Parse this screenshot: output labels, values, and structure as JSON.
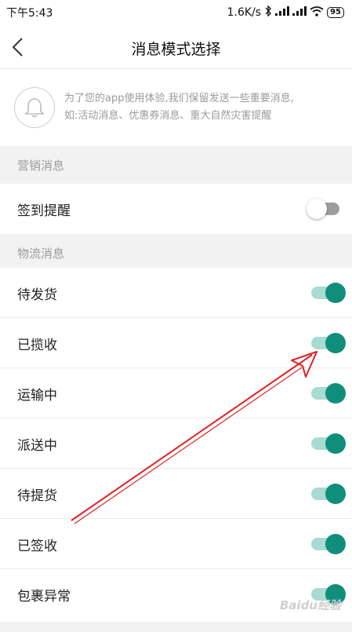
{
  "status_bar": {
    "time": "下午5:43",
    "speed": "1.6K/s",
    "battery": "95"
  },
  "header": {
    "title": "消息模式选择"
  },
  "notice": {
    "icon": "bell-icon",
    "line1": "为了您的app使用体验,我们保留发送一些重要消息,",
    "line2": "如:活动消息、优惠券消息、重大自然灾害提醒"
  },
  "sections": {
    "marketing": {
      "title": "营销消息",
      "items": [
        {
          "label": "签到提醒",
          "enabled": false
        }
      ]
    },
    "logistics": {
      "title": "物流消息",
      "items": [
        {
          "label": "待发货",
          "enabled": true
        },
        {
          "label": "已揽收",
          "enabled": true
        },
        {
          "label": "运输中",
          "enabled": true
        },
        {
          "label": "派送中",
          "enabled": true
        },
        {
          "label": "待提货",
          "enabled": true
        },
        {
          "label": "已签收",
          "enabled": true
        },
        {
          "label": "包裹异常",
          "enabled": true
        }
      ]
    }
  },
  "colors": {
    "toggle_on_knob": "#0f8f7a",
    "toggle_on_track": "#a8dbd1",
    "toggle_off_track": "#9d9d9d",
    "annotation_arrow": "#e02020"
  },
  "watermark": "Baidu经验"
}
